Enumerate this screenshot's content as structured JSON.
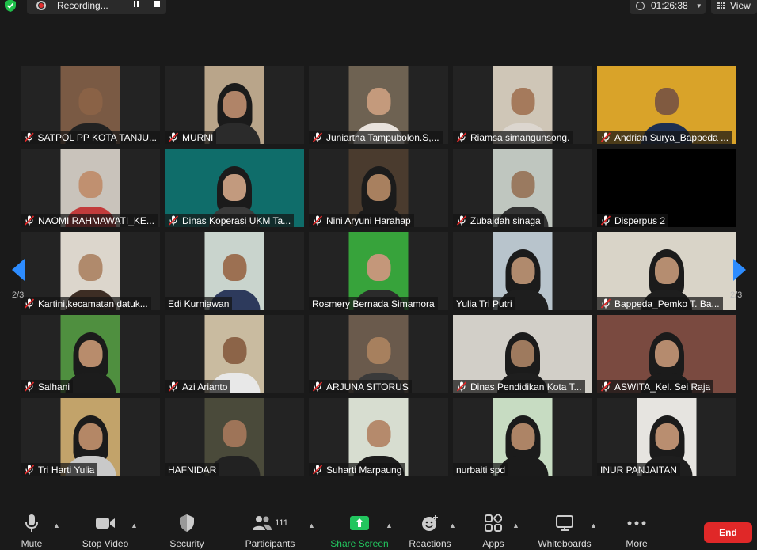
{
  "recording": {
    "label": "Recording..."
  },
  "timer": {
    "value": "01:26:38"
  },
  "view": {
    "label": "View"
  },
  "pagination": {
    "left_page": "2/3",
    "right_page": "2/3"
  },
  "participants": [
    {
      "name": "SATPOL PP KOTA TANJU...",
      "muted": true,
      "bg": "#7a5a44",
      "skin": "#8a6246",
      "cloth": "#222"
    },
    {
      "name": "MURNI",
      "muted": true,
      "bg": "#b9a58a",
      "skin": "#b08468",
      "cloth": "#2b2b2b",
      "hijab": true
    },
    {
      "name": "Juniartha Tampubolon.S,...",
      "muted": true,
      "bg": "#6e6252",
      "skin": "#c49a7c",
      "cloth": "#e9e2dc"
    },
    {
      "name": "Riamsa simangunsong.",
      "muted": true,
      "bg": "#cfc6b7",
      "skin": "#a57a5c",
      "cloth": "#dcd6cf"
    },
    {
      "name": "Andrian Surya_Bappeda ...",
      "muted": true,
      "bg": "#d9a329",
      "skin": "#805a40",
      "cloth": "#1e2f50",
      "wide": true
    },
    {
      "name": "NAOMI RAHMAWATI_KE...",
      "muted": true,
      "bg": "#c9c3bb",
      "skin": "#c09070",
      "cloth": "#c23b3b"
    },
    {
      "name": "Dinas Koperasi UKM Ta...",
      "muted": true,
      "bg": "#0f6d6a",
      "skin": "#c29a7e",
      "cloth": "#3a3a3a",
      "hijab": true,
      "wide": true
    },
    {
      "name": "Nini Aryuni Harahap",
      "muted": true,
      "bg": "#4a3b2e",
      "skin": "#a8805f",
      "cloth": "#1b1b1b",
      "hijab": true
    },
    {
      "name": "Zubaidah sinaga",
      "muted": true,
      "bg": "#bfc6bf",
      "skin": "#9a7a60",
      "cloth": "#333"
    },
    {
      "name": "Disperpus 2",
      "muted": true,
      "black": true
    },
    {
      "name": "Kartini,kecamatan datuk...",
      "muted": true,
      "bg": "#dcd6cc",
      "skin": "#b08a6c",
      "cloth": "#3d2d24"
    },
    {
      "name": "Edi Kurniawan",
      "muted": false,
      "bg": "#c9d4cd",
      "skin": "#9c7052",
      "cloth": "#2d3a5c"
    },
    {
      "name": "Rosmery Bernada Simamora",
      "muted": false,
      "bg": "#37a33b",
      "skin": "#c4977a",
      "cloth": "#2b2b2b"
    },
    {
      "name": "Yulia Tri Putri",
      "muted": false,
      "bg": "#b8c4cc",
      "skin": "#b08a6d",
      "cloth": "#1e1e1e",
      "hijab": true
    },
    {
      "name": "Bappeda_Pemko T. Ba...",
      "muted": true,
      "bg": "#d9d4c8",
      "skin": "#b58d70",
      "cloth": "#1e1e1e",
      "hijab": true,
      "wide": true
    },
    {
      "name": "Salhani",
      "muted": true,
      "bg": "#4f8f3f",
      "skin": "#b88c6c",
      "cloth": "#1c1c1c",
      "hijab": true
    },
    {
      "name": "Azi Arianto",
      "muted": true,
      "bg": "#c9bba0",
      "skin": "#8c6448",
      "cloth": "#e8e8e8"
    },
    {
      "name": "ARJUNA SITORUS",
      "muted": true,
      "bg": "#6a5a4c",
      "skin": "#a7805e",
      "cloth": "#3a3a3a"
    },
    {
      "name": "Dinas Pendidikan Kota T...",
      "muted": true,
      "bg": "#d2cfc8",
      "skin": "#9e7a5e",
      "cloth": "#1e1e1e",
      "hijab": true,
      "wide": true
    },
    {
      "name": "ASWITA_Kel. Sei Raja",
      "muted": true,
      "bg": "#7a4a40",
      "skin": "#b58b6e",
      "cloth": "#1b1b1b",
      "hijab": true,
      "wide": true
    },
    {
      "name": "Tri Harti Yulia",
      "muted": true,
      "bg": "#c2a36a",
      "skin": "#b48766",
      "cloth": "#c9c9c9",
      "hijab": true
    },
    {
      "name": "HAFNIDAR",
      "muted": false,
      "bg": "#4a4a3a",
      "skin": "#9e7458",
      "cloth": "#222"
    },
    {
      "name": "Suharti Marpaung",
      "muted": true,
      "bg": "#d7ddd0",
      "skin": "#b58a6c",
      "cloth": "#1c1c1c"
    },
    {
      "name": "nurbaiti spd",
      "muted": false,
      "bg": "#c7dcc2",
      "skin": "#ad8466",
      "cloth": "#1b1b1b",
      "hijab": true
    },
    {
      "name": "INUR PANJAITAN",
      "muted": false,
      "bg": "#e6e4e0",
      "skin": "#b98e70",
      "cloth": "#1e1e1e",
      "hijab": true
    }
  ],
  "toolbar": {
    "mute": "Mute",
    "stop_video": "Stop Video",
    "security": "Security",
    "participants": "Participants",
    "participants_count": "111",
    "share_screen": "Share Screen",
    "reactions": "Reactions",
    "apps": "Apps",
    "whiteboards": "Whiteboards",
    "more": "More",
    "end": "End"
  },
  "colors": {
    "share_green": "#22c55e",
    "end_red": "#e02828",
    "arrow_blue": "#2d8cff"
  }
}
